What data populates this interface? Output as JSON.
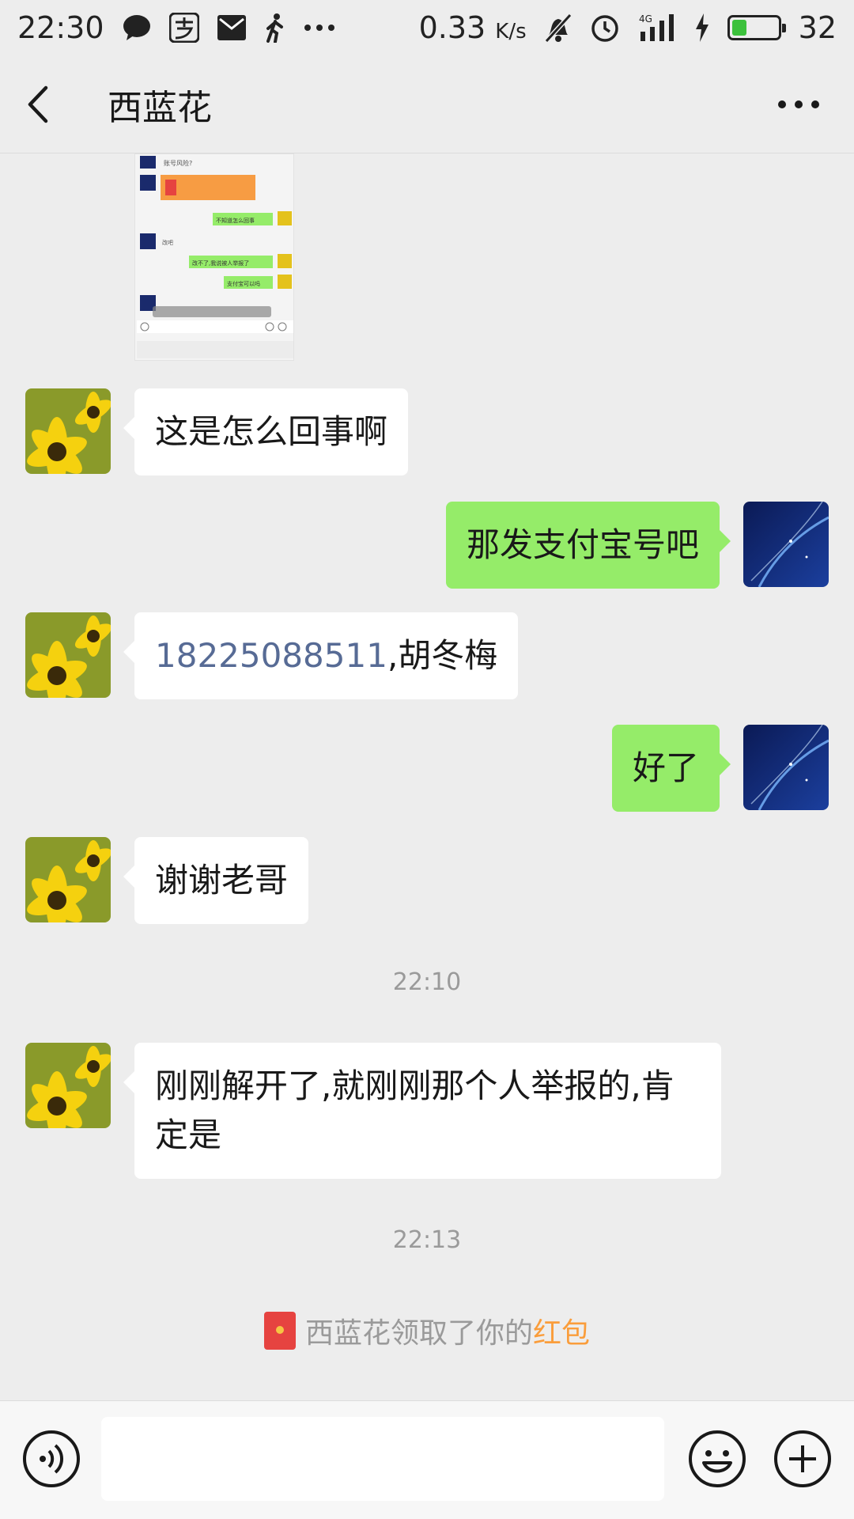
{
  "status_bar": {
    "time": "22:30",
    "speed": "0.33",
    "speed_unit": "K/s",
    "network": "4G",
    "battery": "32",
    "battery_level": 0.32
  },
  "header": {
    "title": "西蓝花"
  },
  "thumbnail": {
    "lines": [
      "账号风险?",
      "不知道怎么回事",
      "改吧",
      "改不了,我说被人举报了",
      "支付宝可以吗"
    ]
  },
  "messages": [
    {
      "from": "other",
      "text": "这是怎么回事啊"
    },
    {
      "from": "me",
      "text": "那发支付宝号吧"
    },
    {
      "from": "other",
      "phone": "18225088511",
      "text": ",胡冬梅"
    },
    {
      "from": "me",
      "text": "好了"
    },
    {
      "from": "other",
      "text": "谢谢老哥"
    },
    {
      "type": "time",
      "text": "22:10"
    },
    {
      "from": "other",
      "text": "刚刚解开了,就刚刚那个人举报的,肯定是"
    },
    {
      "type": "time",
      "text": "22:13"
    },
    {
      "type": "system",
      "text": "西蓝花领取了你的",
      "highlight": "红包"
    }
  ],
  "colors": {
    "background": "#ededed",
    "my_bubble": "#95ec69",
    "other_bubble": "#ffffff",
    "link": "#576b95",
    "highlight": "#fa9d3b"
  },
  "icons": [
    "chat-icon",
    "alipay-icon",
    "mail-icon",
    "walking-icon",
    "more-dots-icon",
    "mute-bell-icon",
    "alarm-icon",
    "signal-icon",
    "charging-icon",
    "battery-icon",
    "back-chevron-icon",
    "voice-icon",
    "emoji-icon",
    "plus-icon",
    "red-packet-icon"
  ]
}
